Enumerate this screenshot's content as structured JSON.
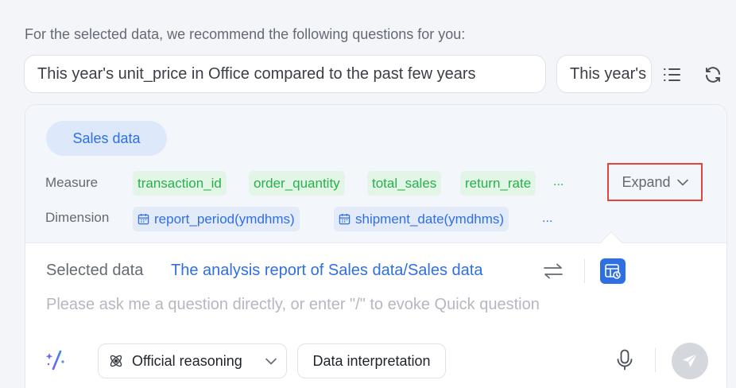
{
  "header": {
    "recommend_text": "For the selected data, we recommend the following questions for you:"
  },
  "suggestions": [
    "This year's unit_price in Office compared to the past few years",
    "This year's"
  ],
  "toolbar_icons": {
    "list": "list-icon",
    "refresh": "refresh-icon"
  },
  "dataset": {
    "tab_label": "Sales data",
    "measure_label": "Measure",
    "dimension_label": "Dimension",
    "measures": [
      "transaction_id",
      "order_quantity",
      "total_sales",
      "return_rate"
    ],
    "measures_more": "...",
    "dimensions": [
      "report_period(ymdhms)",
      "shipment_date(ymdhms)"
    ],
    "dimensions_more": "...",
    "expand_label": "Expand"
  },
  "selected": {
    "label": "Selected data",
    "value": "The analysis report of Sales data/Sales data"
  },
  "input": {
    "placeholder": "Please ask me a question directly, or enter \"/\" to evoke Quick question",
    "value": ""
  },
  "bottom": {
    "reasoning_label": "Official reasoning",
    "interpretation_label": "Data interpretation"
  },
  "colors": {
    "accent": "#2f6fe4",
    "measure_green": "#27b04b",
    "highlight_red": "#e1453c"
  }
}
